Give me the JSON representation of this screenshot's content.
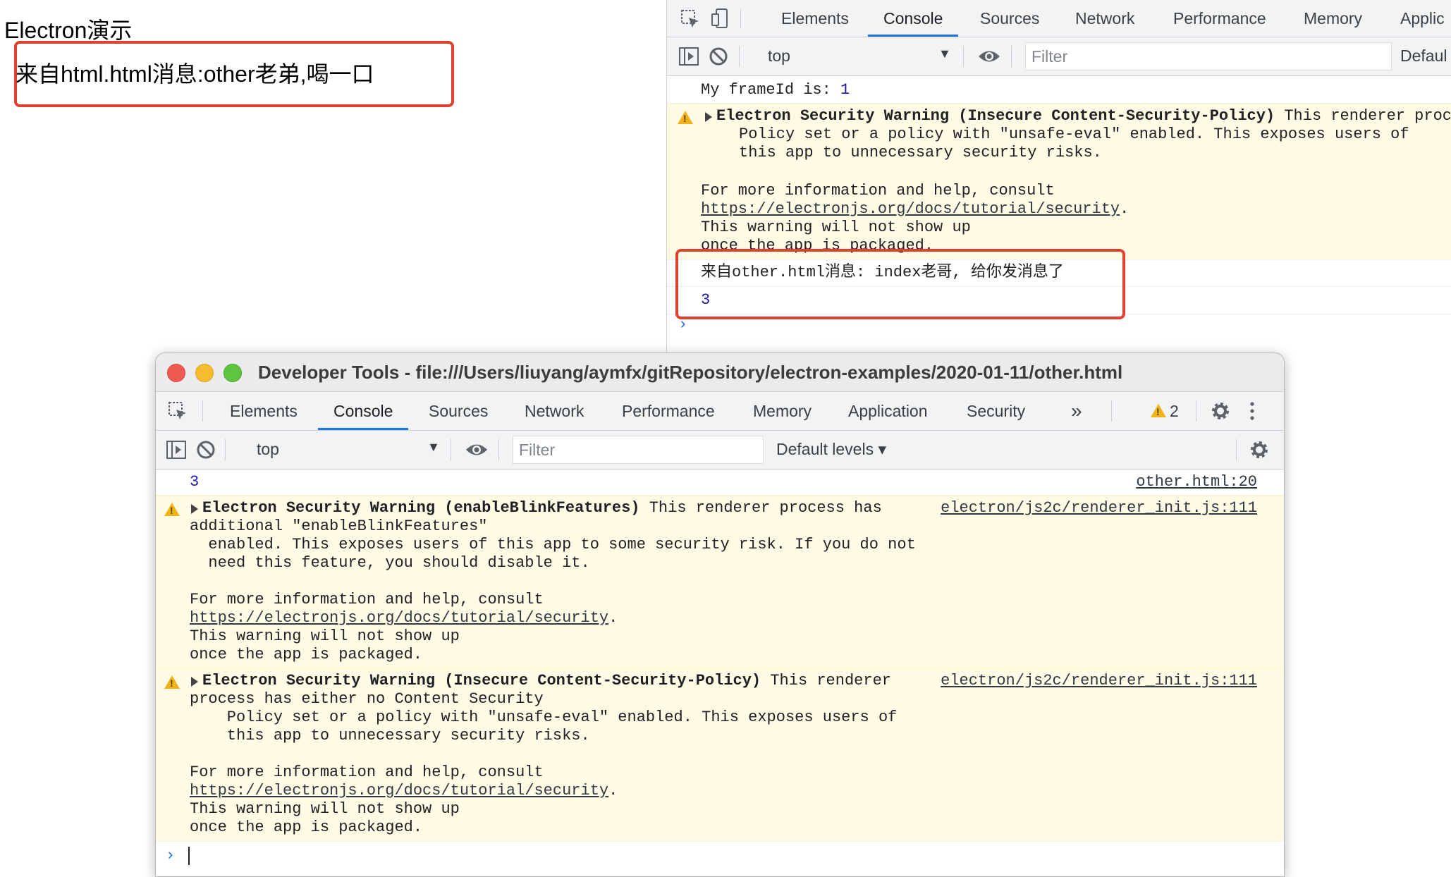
{
  "app": {
    "title": "Electron演示",
    "message": "来自html.html消息:other老弟,喝一口"
  },
  "right_devtools": {
    "tabs": [
      "Elements",
      "Console",
      "Sources",
      "Network",
      "Performance",
      "Memory",
      "Applic"
    ],
    "active_tab": "Console",
    "context": "top",
    "filter_placeholder": "Filter",
    "levels_label": "Defaul",
    "frame_line_prefix": "My frameId is: ",
    "frame_id": "1",
    "warning": {
      "title": "Electron Security Warning (Insecure Content-Security-Policy)",
      "tail": " This renderer proc",
      "lines": [
        "Policy set or a policy with \"unsafe-eval\" enabled. This exposes users of",
        "this app to unnecessary security risks."
      ],
      "more": "For more information and help, consult",
      "link": "https://electronjs.org/docs/tutorial/security",
      "link_suffix": ".",
      "show1": "This warning will not show up",
      "show2": "once the app is packaged."
    },
    "message_line": "来自other.html消息: index老哥, 给你发消息了",
    "number_line": "3"
  },
  "floating_devtools": {
    "window_title": "Developer Tools - file:///Users/liuyang/aymfx/gitRepository/electron-examples/2020-01-11/other.html",
    "tabs": [
      "Elements",
      "Console",
      "Sources",
      "Network",
      "Performance",
      "Memory",
      "Application",
      "Security"
    ],
    "active_tab": "Console",
    "more_tabs": "»",
    "warning_count": "2",
    "context": "top",
    "filter_placeholder": "Filter",
    "levels_label": "Default levels ▾",
    "row1": {
      "value": "3",
      "source": "other.html:20"
    },
    "warning1": {
      "title": "Electron Security Warning (enableBlinkFeatures)",
      "tail": " This renderer process has",
      "source": "electron/js2c/renderer_init.js:111",
      "l1": "additional \"enableBlinkFeatures\"",
      "l2": "  enabled. This exposes users of this app to some security risk. If you do not",
      "l3": "  need this feature, you should disable it.",
      "more": "For more information and help, consult",
      "link": "https://electronjs.org/docs/tutorial/security",
      "link_suffix": ".",
      "show1": "This warning will not show up",
      "show2": "once the app is packaged."
    },
    "warning2": {
      "title": "Electron Security Warning (Insecure Content-Security-Policy)",
      "tail": " This renderer",
      "source": "electron/js2c/renderer_init.js:111",
      "l1": "process has either no Content Security",
      "l2": "    Policy set or a policy with \"unsafe-eval\" enabled. This exposes users of",
      "l3": "    this app to unnecessary security risks.",
      "more": "For more information and help, consult",
      "link": "https://electronjs.org/docs/tutorial/security",
      "link_suffix": ".",
      "show1": "This warning will not show up",
      "show2": "once the app is packaged."
    }
  }
}
